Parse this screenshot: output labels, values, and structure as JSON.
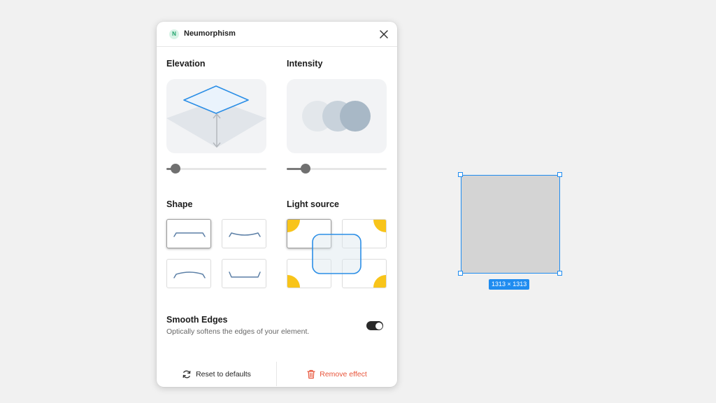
{
  "panel": {
    "logo_letter": "N",
    "title": "Neumorphism",
    "close_icon": "close-icon"
  },
  "elevation": {
    "label": "Elevation",
    "slider_fraction": 0.09
  },
  "intensity": {
    "label": "Intensity",
    "slider_fraction": 0.19
  },
  "shape": {
    "label": "Shape",
    "options": [
      "flat",
      "concave",
      "convex",
      "pressed"
    ],
    "selected": "flat"
  },
  "light_source": {
    "label": "Light source",
    "options": [
      "top-left",
      "top-right",
      "bottom-left",
      "bottom-right"
    ],
    "selected": "top-left"
  },
  "smooth_edges": {
    "title": "Smooth Edges",
    "description": "Optically softens the edges of your element.",
    "enabled": true
  },
  "footer": {
    "reset_label": "Reset to defaults",
    "reset_icon": "refresh-icon",
    "remove_label": "Remove effect",
    "remove_icon": "trash-icon"
  },
  "canvas": {
    "dimensions_label": "1313 × 1313"
  },
  "colors": {
    "accent": "#1f8cf0",
    "danger": "#e8543a",
    "light_dot": "#f8c41a",
    "shape_stroke": "#5b7fa6"
  }
}
